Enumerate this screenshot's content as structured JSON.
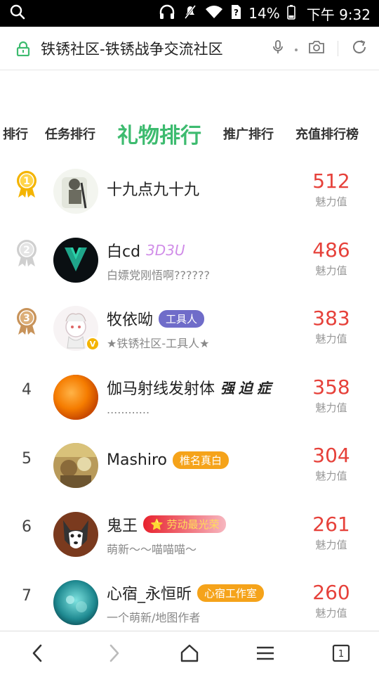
{
  "status_bar": {
    "battery": "14%",
    "time": "下午 9:32"
  },
  "browser": {
    "url_title": "铁锈社区-铁锈战争交流社区"
  },
  "tabs": [
    {
      "label": "排行"
    },
    {
      "label": "任务排行"
    },
    {
      "label": "礼物排行"
    },
    {
      "label": "推广排行"
    },
    {
      "label": "充值排行榜"
    }
  ],
  "active_tab": "礼物排行",
  "colors": {
    "accent": "#3dbb6f",
    "score": "#e6413a",
    "gold": "#f4b400",
    "silver": "#cfcfcf",
    "bronze": "#c8935a"
  },
  "ranking": [
    {
      "rank": "1",
      "medal": "gold",
      "name": "十九点九十九",
      "sub": "",
      "tag": "",
      "deco": "",
      "score": "512",
      "unit": "魅力值"
    },
    {
      "rank": "2",
      "medal": "silver",
      "name": "白cd",
      "sub": "白嫖党刚悟啊??????",
      "tag": "",
      "deco": "3D3U",
      "score": "486",
      "unit": "魅力值"
    },
    {
      "rank": "3",
      "medal": "bronze",
      "name": "牧依呦",
      "sub": "★铁锈社区-工具人★",
      "tag": "工具人",
      "deco": "",
      "score": "383",
      "unit": "魅力值"
    },
    {
      "rank": "4",
      "medal": "",
      "name": "伽马射线发射体",
      "sub": "............",
      "tag": "",
      "deco": "强迫症",
      "score": "358",
      "unit": "魅力值"
    },
    {
      "rank": "5",
      "medal": "",
      "name": "Mashiro",
      "sub": "",
      "tag": "椎名真白",
      "deco": "",
      "score": "304",
      "unit": "魅力值"
    },
    {
      "rank": "6",
      "medal": "",
      "name": "鬼王",
      "sub": "萌新～～喵喵喵～",
      "tag": "⭐ 劳动最光荣",
      "deco": "",
      "score": "261",
      "unit": "魅力值"
    },
    {
      "rank": "7",
      "medal": "",
      "name": "心宿_永恒昕",
      "sub": "一个萌新/地图作者",
      "tag": "心宿工作室",
      "deco": "",
      "score": "260",
      "unit": "魅力值"
    }
  ],
  "bottom_nav": {
    "tab_count": "1"
  }
}
